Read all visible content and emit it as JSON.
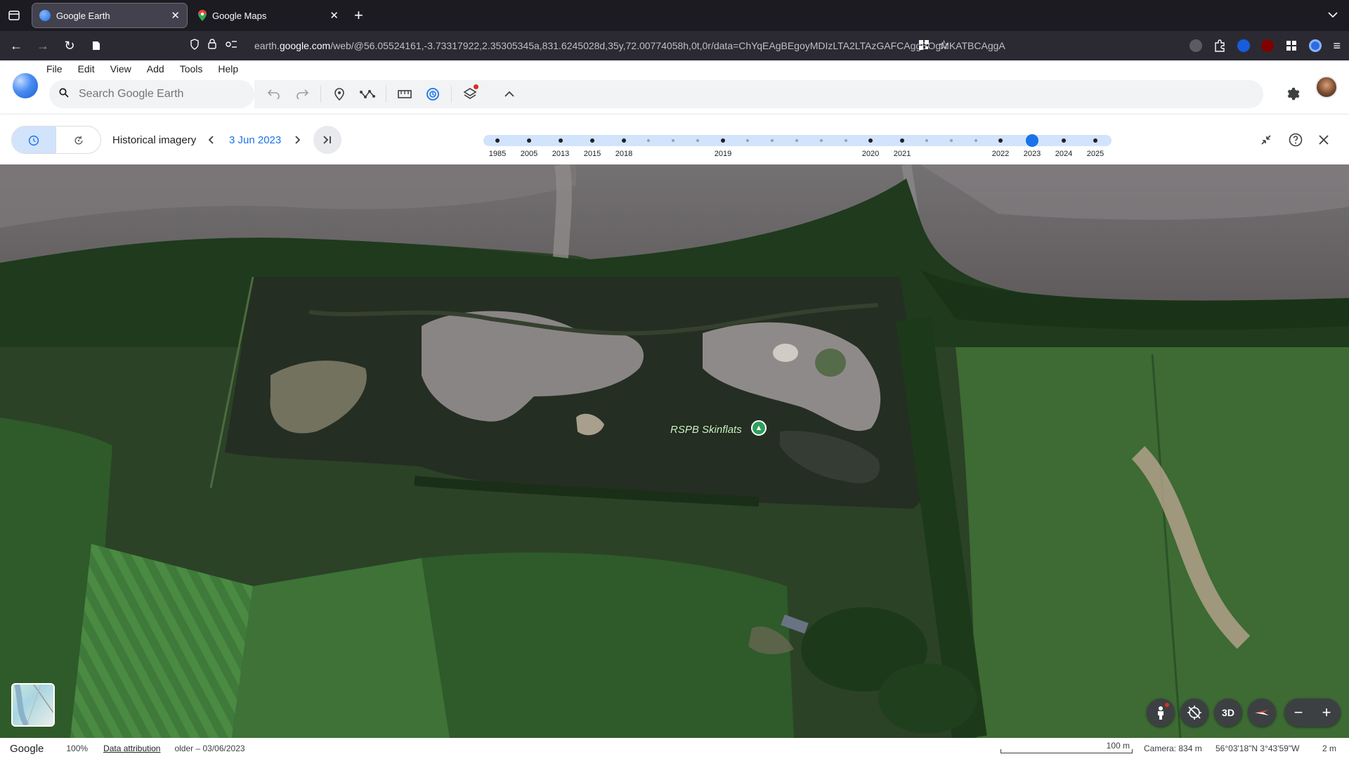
{
  "browser": {
    "tabs": [
      {
        "title": "Google Earth",
        "active": true
      },
      {
        "title": "Google Maps",
        "active": false
      }
    ],
    "url": {
      "prefix": "earth.",
      "domain": "google.com",
      "rest": "/web/@56.05524161,-3.73317922,2.35305345a,831.6245028d,35y,72.00774058h,0t,0r/data=ChYqEAgBEgoyMDIzLTA2LTAzGAFCAggBOgMKATBCAggA"
    }
  },
  "earth": {
    "menus": [
      "File",
      "Edit",
      "View",
      "Add",
      "Tools",
      "Help"
    ],
    "search_placeholder": "Search Google Earth",
    "accent_color": "#1a73e8"
  },
  "history": {
    "label": "Historical imagery",
    "selected_date": "3 Jun 2023",
    "timeline_years": [
      "1985",
      "2005",
      "2013",
      "2015",
      "2018",
      "2019",
      "2020",
      "2021",
      "2022",
      "2023",
      "2024",
      "2025"
    ],
    "selected_year": "2023"
  },
  "map": {
    "place_label": "RSPB Skinflats"
  },
  "status": {
    "brand": "Google",
    "zoom": "100%",
    "attribution": "Data attribution",
    "imagery_date": "older – 03/06/2023",
    "scale_label": "100 m",
    "camera": "Camera: 834 m",
    "coords": "56°03'18\"N 3°43'59\"W",
    "elevation": "2 m"
  }
}
